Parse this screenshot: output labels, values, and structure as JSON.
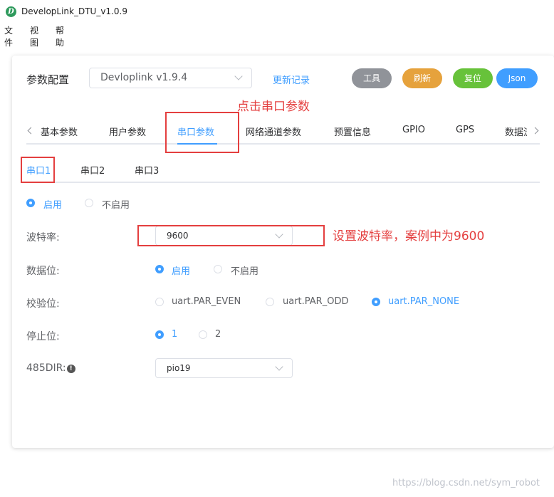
{
  "window": {
    "title": "DevelopLink_DTU_v1.0.9",
    "icon_letter": "D"
  },
  "menu": {
    "file": "文件",
    "view": "视图",
    "help": "帮助"
  },
  "header": {
    "label": "参数配置",
    "version_select": "Devloplink v1.9.4",
    "changelog_link": "更新记录",
    "buttons": {
      "tools": "工具",
      "refresh": "刷新",
      "reset": "复位",
      "json": "Json"
    },
    "button_colors": {
      "tools": "#909399",
      "refresh": "#e6a23c",
      "reset": "#67c23a",
      "json": "#409eff"
    }
  },
  "main_tabs": [
    "基本参数",
    "用户参数",
    "串口参数",
    "网络通道参数",
    "预置信息",
    "GPIO",
    "GPS",
    "数据流"
  ],
  "active_main_tab": "串口参数",
  "sub_tabs": [
    "串口1",
    "串口2",
    "串口3"
  ],
  "active_sub_tab": "串口1",
  "form": {
    "enable": {
      "on": "启用",
      "off": "不启用",
      "selected": "启用"
    },
    "baud": {
      "label": "波特率:",
      "value": "9600"
    },
    "data_bits": {
      "label": "数据位:",
      "on": "启用",
      "off": "不启用",
      "selected": "启用"
    },
    "parity": {
      "label": "校验位:",
      "options": [
        "uart.PAR_EVEN",
        "uart.PAR_ODD",
        "uart.PAR_NONE"
      ],
      "selected": "uart.PAR_NONE"
    },
    "stop_bits": {
      "label": "停止位:",
      "options": [
        "1",
        "2"
      ],
      "selected": "1"
    },
    "dir485": {
      "label": "485DIR:",
      "info_glyph": "!",
      "value": "pio19"
    }
  },
  "annotations": {
    "click_serial": "点击串口参数",
    "set_baud": "设置波特率，案例中为9600"
  },
  "watermark": "https://blog.csdn.net/sym_robot"
}
